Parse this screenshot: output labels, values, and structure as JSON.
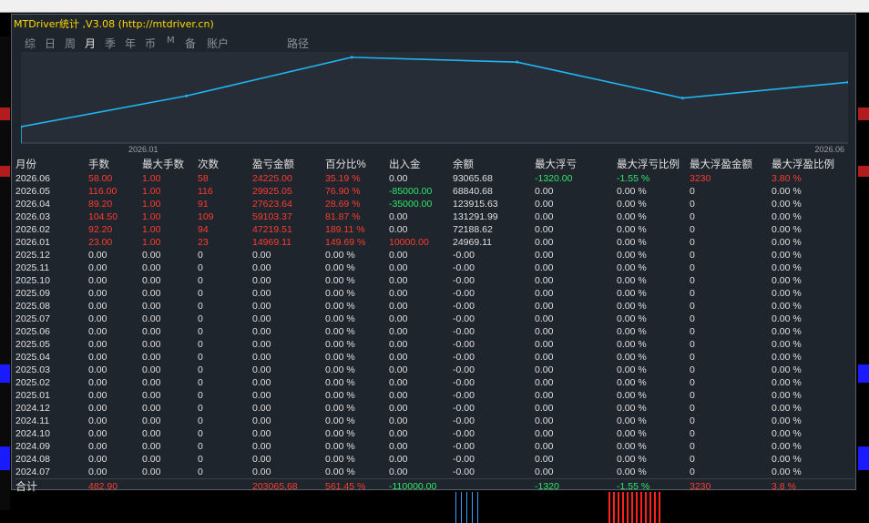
{
  "title": "MTDriver统计 ,V3.08 (http://mtdriver.cn)",
  "tabs": [
    {
      "label": "综",
      "active": false
    },
    {
      "label": "日",
      "active": false
    },
    {
      "label": "周",
      "active": false
    },
    {
      "label": "月",
      "active": true
    },
    {
      "label": "季",
      "active": false
    },
    {
      "label": "年",
      "active": false
    },
    {
      "label": "币",
      "active": false
    },
    {
      "label": "M",
      "active": false
    },
    {
      "label": "备",
      "active": false
    },
    {
      "label": "账户",
      "active": false
    },
    {
      "label": "路径",
      "active": false
    }
  ],
  "chart_data": {
    "type": "line",
    "x": [
      "2026.01",
      "2026.02",
      "2026.03",
      "2026.04",
      "2026.05",
      "2026.06"
    ],
    "series": [
      {
        "values": [
          24969.11,
          72188.62,
          131291.99,
          123915.63,
          68840.68,
          93065.68
        ]
      }
    ],
    "tick_labels": [
      "2026.01",
      "2026.06"
    ],
    "color": "#1fb5f0",
    "grid": false
  },
  "headers": [
    "月份",
    "手数",
    "最大手数",
    "次数",
    "盈亏金额",
    "百分比%",
    "出入金",
    "余额",
    "最大浮亏",
    "最大浮亏比例",
    "最大浮盈金额",
    "最大浮盈比例"
  ],
  "rows": [
    [
      "2026.06",
      "58.00",
      "1.00",
      "58",
      "24225.00",
      "35.19 %",
      "0.00",
      "93065.68",
      "-1320.00",
      "-1.55 %",
      "3230",
      "3.80 %"
    ],
    [
      "2026.05",
      "116.00",
      "1.00",
      "116",
      "29925.05",
      "76.90 %",
      "-85000.00",
      "68840.68",
      "0.00",
      "0.00 %",
      "0",
      "0.00 %"
    ],
    [
      "2026.04",
      "89.20",
      "1.00",
      "91",
      "27623.64",
      "28.69 %",
      "-35000.00",
      "123915.63",
      "0.00",
      "0.00 %",
      "0",
      "0.00 %"
    ],
    [
      "2026.03",
      "104.50",
      "1.00",
      "109",
      "59103.37",
      "81.87 %",
      "0.00",
      "131291.99",
      "0.00",
      "0.00 %",
      "0",
      "0.00 %"
    ],
    [
      "2026.02",
      "92.20",
      "1.00",
      "94",
      "47219.51",
      "189.11 %",
      "0.00",
      "72188.62",
      "0.00",
      "0.00 %",
      "0",
      "0.00 %"
    ],
    [
      "2026.01",
      "23.00",
      "1.00",
      "23",
      "14969.11",
      "149.69 %",
      "10000.00",
      "24969.11",
      "0.00",
      "0.00 %",
      "0",
      "0.00 %"
    ],
    [
      "2025.12",
      "0.00",
      "0.00",
      "0",
      "0.00",
      "0.00 %",
      "0.00",
      "-0.00",
      "0.00",
      "0.00 %",
      "0",
      "0.00 %"
    ],
    [
      "2025.11",
      "0.00",
      "0.00",
      "0",
      "0.00",
      "0.00 %",
      "0.00",
      "-0.00",
      "0.00",
      "0.00 %",
      "0",
      "0.00 %"
    ],
    [
      "2025.10",
      "0.00",
      "0.00",
      "0",
      "0.00",
      "0.00 %",
      "0.00",
      "-0.00",
      "0.00",
      "0.00 %",
      "0",
      "0.00 %"
    ],
    [
      "2025.09",
      "0.00",
      "0.00",
      "0",
      "0.00",
      "0.00 %",
      "0.00",
      "-0.00",
      "0.00",
      "0.00 %",
      "0",
      "0.00 %"
    ],
    [
      "2025.08",
      "0.00",
      "0.00",
      "0",
      "0.00",
      "0.00 %",
      "0.00",
      "-0.00",
      "0.00",
      "0.00 %",
      "0",
      "0.00 %"
    ],
    [
      "2025.07",
      "0.00",
      "0.00",
      "0",
      "0.00",
      "0.00 %",
      "0.00",
      "-0.00",
      "0.00",
      "0.00 %",
      "0",
      "0.00 %"
    ],
    [
      "2025.06",
      "0.00",
      "0.00",
      "0",
      "0.00",
      "0.00 %",
      "0.00",
      "-0.00",
      "0.00",
      "0.00 %",
      "0",
      "0.00 %"
    ],
    [
      "2025.05",
      "0.00",
      "0.00",
      "0",
      "0.00",
      "0.00 %",
      "0.00",
      "-0.00",
      "0.00",
      "0.00 %",
      "0",
      "0.00 %"
    ],
    [
      "2025.04",
      "0.00",
      "0.00",
      "0",
      "0.00",
      "0.00 %",
      "0.00",
      "-0.00",
      "0.00",
      "0.00 %",
      "0",
      "0.00 %"
    ],
    [
      "2025.03",
      "0.00",
      "0.00",
      "0",
      "0.00",
      "0.00 %",
      "0.00",
      "-0.00",
      "0.00",
      "0.00 %",
      "0",
      "0.00 %"
    ],
    [
      "2025.02",
      "0.00",
      "0.00",
      "0",
      "0.00",
      "0.00 %",
      "0.00",
      "-0.00",
      "0.00",
      "0.00 %",
      "0",
      "0.00 %"
    ],
    [
      "2025.01",
      "0.00",
      "0.00",
      "0",
      "0.00",
      "0.00 %",
      "0.00",
      "-0.00",
      "0.00",
      "0.00 %",
      "0",
      "0.00 %"
    ],
    [
      "2024.12",
      "0.00",
      "0.00",
      "0",
      "0.00",
      "0.00 %",
      "0.00",
      "-0.00",
      "0.00",
      "0.00 %",
      "0",
      "0.00 %"
    ],
    [
      "2024.11",
      "0.00",
      "0.00",
      "0",
      "0.00",
      "0.00 %",
      "0.00",
      "-0.00",
      "0.00",
      "0.00 %",
      "0",
      "0.00 %"
    ],
    [
      "2024.10",
      "0.00",
      "0.00",
      "0",
      "0.00",
      "0.00 %",
      "0.00",
      "-0.00",
      "0.00",
      "0.00 %",
      "0",
      "0.00 %"
    ],
    [
      "2024.09",
      "0.00",
      "0.00",
      "0",
      "0.00",
      "0.00 %",
      "0.00",
      "-0.00",
      "0.00",
      "0.00 %",
      "0",
      "0.00 %"
    ],
    [
      "2024.08",
      "0.00",
      "0.00",
      "0",
      "0.00",
      "0.00 %",
      "0.00",
      "-0.00",
      "0.00",
      "0.00 %",
      "0",
      "0.00 %"
    ],
    [
      "2024.07",
      "0.00",
      "0.00",
      "0",
      "0.00",
      "0.00 %",
      "0.00",
      "-0.00",
      "0.00",
      "0.00 %",
      "0",
      "0.00 %"
    ]
  ],
  "totals": {
    "label": "合计",
    "lots": "482.90",
    "pl": "203065.68",
    "pct": "561.45 %",
    "deposit": "-110000.00",
    "max_loss": "-1320",
    "max_loss_pct": "-1.55 %",
    "max_gain": "3230",
    "max_gain_pct": "3.8 %"
  },
  "colors": {
    "profit": "#ff3b30",
    "loss": "#2ee86a",
    "text": "#e0e0e0",
    "line": "#1fb5f0",
    "panel": "#1f252d"
  }
}
